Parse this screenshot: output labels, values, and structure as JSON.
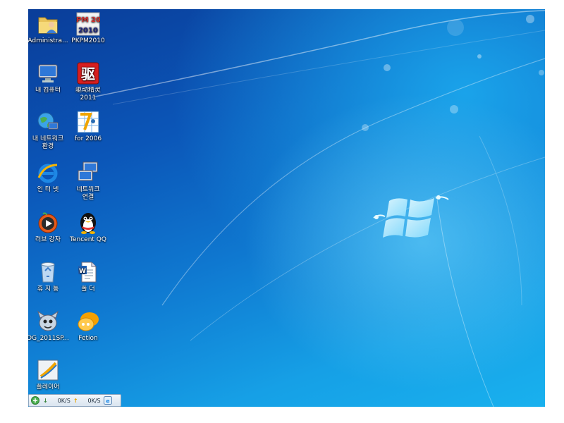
{
  "desktop_icons": [
    {
      "label": "Administra...",
      "icon": "user-folder-icon"
    },
    {
      "label": "PKPM2010",
      "icon": "pkpm-app-icon",
      "art_text": "PKPM 2010"
    },
    {
      "label": "내 컴퓨터",
      "icon": "computer-icon"
    },
    {
      "label": "驱动精灵",
      "label2": "2011",
      "icon": "driver-genius-icon",
      "art_text": "驱"
    },
    {
      "label": "내 네트워크",
      "label2": "환경",
      "icon": "network-globe-icon"
    },
    {
      "label": "for 2006",
      "icon": "cad-app-icon"
    },
    {
      "label": "인 터 넷",
      "icon": "internet-explorer-icon"
    },
    {
      "label": "네트워크",
      "label2": "연결",
      "icon": "network-connections-icon"
    },
    {
      "label": "러브 강자",
      "icon": "media-player-icon"
    },
    {
      "label": "Tencent QQ",
      "icon": "qq-penguin-icon"
    },
    {
      "label": "휴 지 통",
      "icon": "recycle-bin-icon"
    },
    {
      "label": "폴 더",
      "icon": "word-document-icon"
    },
    {
      "label": "DG_2011SP...",
      "icon": "cartoon-app-icon"
    },
    {
      "label": "Fetion",
      "icon": "fetion-icon"
    },
    {
      "label": "플레이어",
      "icon": "player-app-icon"
    }
  ],
  "taskbar": {
    "download_speed": "0K/S",
    "upload_speed": "0K/S"
  },
  "colors": {
    "wallpaper_dark": "#0a3d99",
    "wallpaper_light": "#19b1ee",
    "label_text": "#ffffff"
  }
}
